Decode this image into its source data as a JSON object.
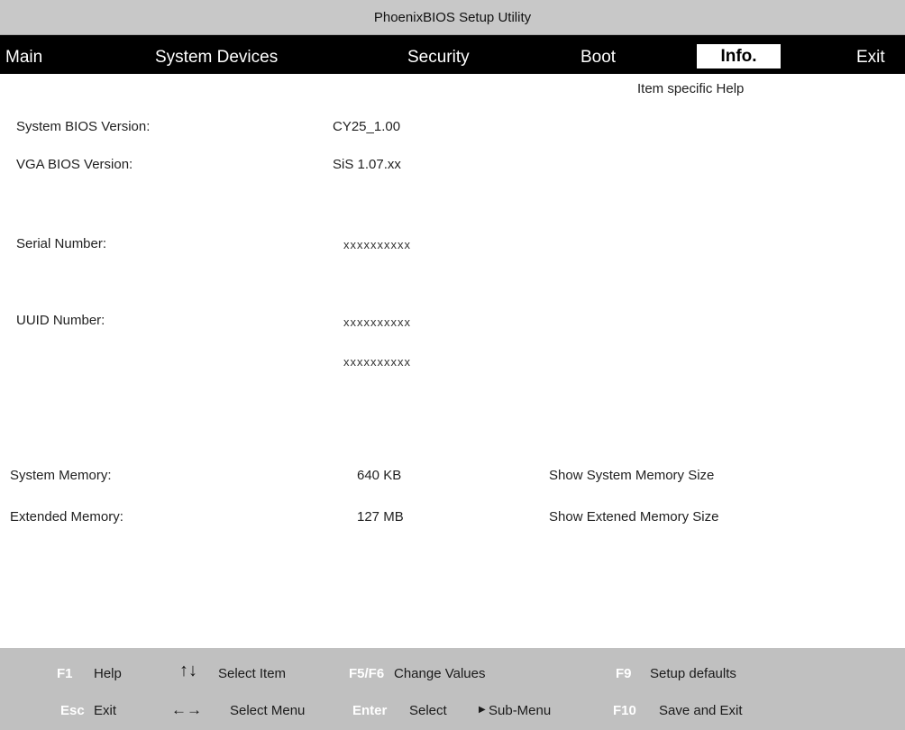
{
  "window": {
    "title": "PhoenixBIOS Setup Utility"
  },
  "menu": {
    "items": [
      {
        "label": "Main"
      },
      {
        "label": "System Devices"
      },
      {
        "label": "Security"
      },
      {
        "label": "Boot"
      },
      {
        "label": "Info."
      },
      {
        "label": "Exit"
      }
    ],
    "active": "Info."
  },
  "help_panel": {
    "title": "Item specific Help"
  },
  "info": {
    "system_bios_version": {
      "label": "System BIOS Version:",
      "value": "CY25_1.00"
    },
    "vga_bios_version": {
      "label": "VGA BIOS Version:",
      "value": "SiS 1.07.xx"
    },
    "serial_number": {
      "label": "Serial Number:",
      "value": "xxxxxxxxxx"
    },
    "uuid_number": {
      "label": "UUID Number:",
      "value_line1": "xxxxxxxxxx",
      "value_line2": "xxxxxxxxxx"
    },
    "system_memory": {
      "label": "System Memory:",
      "value": "640 KB",
      "help": "Show System Memory Size"
    },
    "extended_memory": {
      "label": "Extended Memory:",
      "value": "127 MB",
      "help": "Show Extened Memory Size"
    }
  },
  "footer": {
    "row1": {
      "f1_key": "F1",
      "f1_label": "Help",
      "updown_glyph": "↑↓",
      "select_item": "Select Item",
      "f5f6_key": "F5/F6",
      "change_values": "Change Values",
      "f9_key": "F9",
      "setup_defaults": "Setup defaults"
    },
    "row2": {
      "esc_key": "Esc",
      "esc_label": "Exit",
      "leftright_glyph": "←→",
      "select_menu": "Select Menu",
      "enter_key": "Enter",
      "select_label": "Select",
      "submenu_glyph": "▶",
      "submenu_label": "Sub-Menu",
      "f10_key": "F10",
      "save_and_exit": "Save and Exit"
    }
  }
}
